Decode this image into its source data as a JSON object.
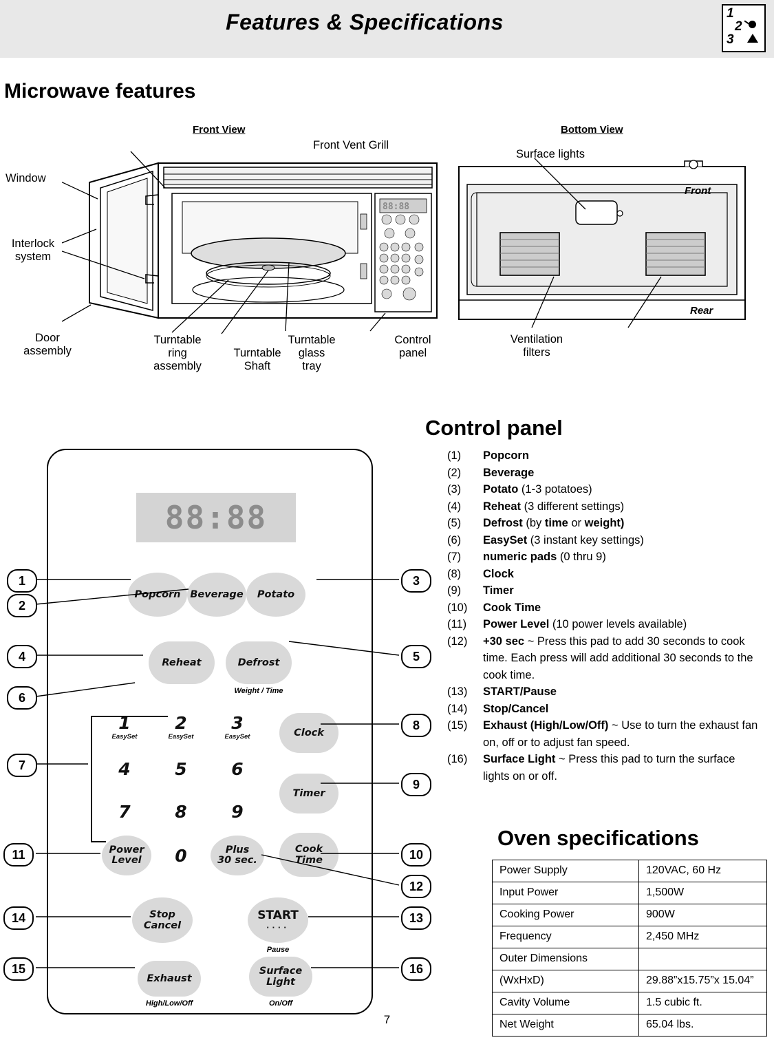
{
  "header": {
    "title": "Features & Specifications",
    "icon_numbers": [
      "1",
      "2",
      "3"
    ]
  },
  "microwave_features": {
    "title": "Microwave features",
    "front_view_label": "Front View",
    "bottom_view_label": "Bottom View",
    "front_callouts": {
      "front_vent_grill": "Front Vent Grill",
      "window": "Window",
      "interlock_system": "Interlock\nsystem",
      "door_assembly": "Door\nassembly",
      "turntable_ring_assembly": "Turntable\nring\nassembly",
      "turntable_shaft": "Turntable\nShaft",
      "turntable_glass_tray": "Turntable\nglass\ntray",
      "control_panel": "Control\npanel"
    },
    "bottom_callouts": {
      "surface_lights": "Surface lights",
      "ventilation_filters": "Ventilation\nfilters",
      "front": "Front",
      "rear": "Rear"
    }
  },
  "control_panel": {
    "title": "Control panel",
    "items": [
      {
        "index": "(1)",
        "bold": "Popcorn",
        "rest": ""
      },
      {
        "index": "(2)",
        "bold": "Beverage",
        "rest": ""
      },
      {
        "index": "(3)",
        "bold": "Potato",
        "rest": " (1-3 potatoes)"
      },
      {
        "index": "(4)",
        "bold": "Reheat",
        "rest": " (3 different settings)"
      },
      {
        "index": "(5)",
        "bold": "Defrost",
        "rest": " (by time or weight)"
      },
      {
        "index": "(6)",
        "bold": "EasySet",
        "rest": " (3 instant key settings)"
      },
      {
        "index": "(7)",
        "bold": "numeric pads",
        "rest": " (0 thru 9)"
      },
      {
        "index": "(8)",
        "bold": "Clock",
        "rest": ""
      },
      {
        "index": "(9)",
        "bold": "Timer",
        "rest": ""
      },
      {
        "index": "(10)",
        "bold": "Cook Time",
        "rest": ""
      },
      {
        "index": "(11)",
        "bold": "Power Level",
        "rest": " (10 power levels available)"
      },
      {
        "index": "(12)",
        "bold": "+30 sec",
        "rest": " ~ Press this pad to add 30 seconds to cook time. Each press will add additional 30 seconds to the cook time."
      },
      {
        "index": "(13)",
        "bold": "START/Pause",
        "rest": ""
      },
      {
        "index": "(14)",
        "bold": "Stop/Cancel",
        "rest": ""
      },
      {
        "index": "(15)",
        "bold": "Exhaust (High/Low/Off",
        "rest": " ~ Use to turn the exhaust fan on, off or to adjust fan speed."
      },
      {
        "index": "(16)",
        "bold": "Surface Light",
        "rest": " ~ Press this pad to turn the surface lights on or off."
      }
    ],
    "keypad": {
      "display": "88:88",
      "popcorn": "Popcorn",
      "beverage": "Beverage",
      "potato": "Potato",
      "reheat": "Reheat",
      "defrost": "Defrost",
      "weight_time": "Weight / Time",
      "easyset_1": "1",
      "easyset_2": "2",
      "easyset_3": "3",
      "easyset_label": "EasySet",
      "n4": "4",
      "n5": "5",
      "n6": "6",
      "n7": "7",
      "n8": "8",
      "n9": "9",
      "n0": "0",
      "power_level": "Power\nLevel",
      "plus30": "Plus\n30 sec.",
      "clock": "Clock",
      "timer": "Timer",
      "cook_time": "Cook\nTime",
      "stop_cancel": "Stop\nCancel",
      "start": "START",
      "pause": "Pause",
      "exhaust": "Exhaust",
      "high_low_off": "High/Low/Off",
      "surface_light": "Surface\nLight",
      "on_off": "On/Off"
    },
    "bubbles": [
      "1",
      "2",
      "4",
      "6",
      "7",
      "11",
      "14",
      "15",
      "3",
      "5",
      "8",
      "9",
      "10",
      "12",
      "13",
      "16"
    ]
  },
  "oven_specifications": {
    "title": "Oven specifications",
    "rows": [
      {
        "key": "Power Supply",
        "value": "120VAC, 60 Hz"
      },
      {
        "key": "Input Power",
        "value": "1,500W"
      },
      {
        "key": "Cooking Power",
        "value": "900W"
      },
      {
        "key": "Frequency",
        "value": "2,450 MHz"
      },
      {
        "key": "Outer Dimensions",
        "value": ""
      },
      {
        "key": "(WxHxD)",
        "value": "29.88”x15.75”x 15.04”"
      },
      {
        "key": "Cavity Volume",
        "value": "1.5 cubic ft."
      },
      {
        "key": "Net Weight",
        "value": "65.04 lbs."
      }
    ]
  },
  "page_number": "7"
}
